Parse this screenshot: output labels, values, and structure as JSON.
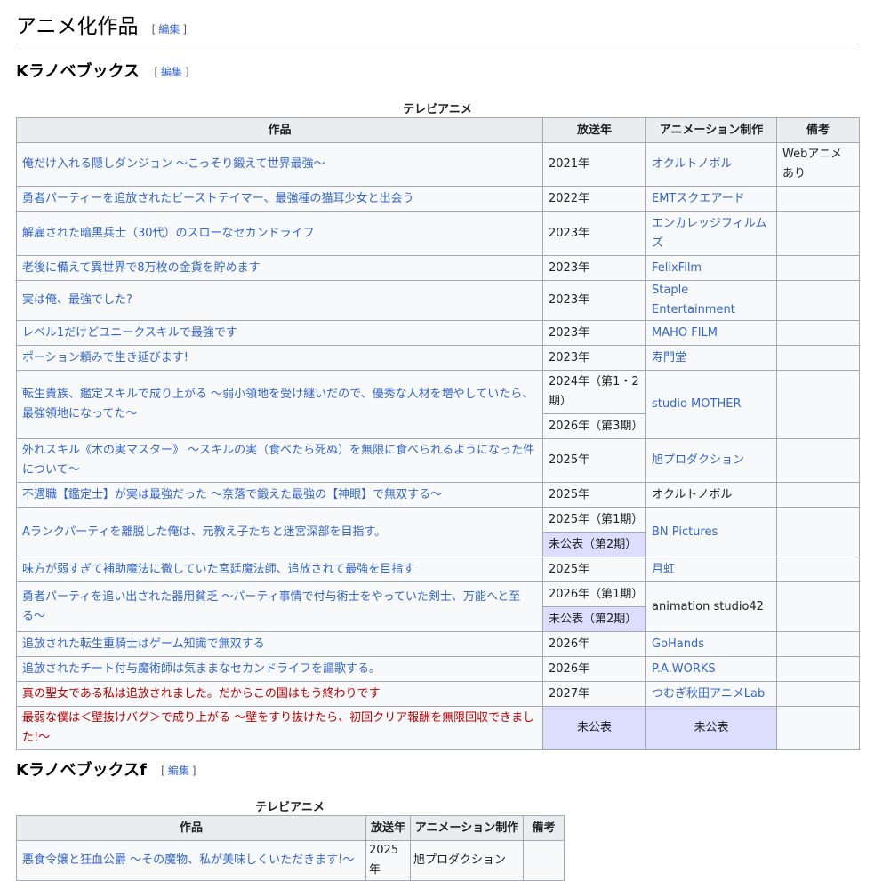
{
  "section": {
    "title": "アニメ化作品",
    "edit_label": "編集"
  },
  "subsections": [
    {
      "title": "Kラノベブックス",
      "edit_label": "編集"
    },
    {
      "title": "Kラノベブックスf",
      "edit_label": "編集"
    }
  ],
  "table1": {
    "caption": "テレビアニメ",
    "headers": [
      "作品",
      "放送年",
      "アニメーション制作",
      "備考"
    ],
    "rows": [
      {
        "title": "俺だけ入れる隠しダンジョン 〜こっそり鍛えて世界最強〜",
        "year": "2021年",
        "studio": "オクルトノボル",
        "note": "Webアニメあり"
      },
      {
        "title": "勇者パーティーを追放されたビーストテイマー、最強種の猫耳少女と出会う",
        "year": "2022年",
        "studio": "EMTスクエアード",
        "note": ""
      },
      {
        "title": "解雇された暗黒兵士（30代）のスローなセカンドライフ",
        "year": "2023年",
        "studio": "エンカレッジフィルムズ",
        "note": ""
      },
      {
        "title": "老後に備えて異世界で8万枚の金貨を貯めます",
        "year": "2023年",
        "studio": "FelixFilm",
        "note": ""
      },
      {
        "title": "実は俺、最強でした?",
        "year": "2023年",
        "studio": "Staple Entertainment",
        "note": ""
      },
      {
        "title": "レベル1だけどユニークスキルで最強です",
        "year": "2023年",
        "studio": "MAHO FILM",
        "note": ""
      },
      {
        "title": "ポーション頼みで生き延びます!",
        "year": "2023年",
        "studio": "寿門堂",
        "note": ""
      },
      {
        "title": "転生貴族、鑑定スキルで成り上がる 〜弱小領地を受け継いだので、優秀な人材を増やしていたら、最強領地になってた〜",
        "years": [
          "2024年（第1・2期）",
          "2026年（第3期）"
        ],
        "studio": "studio MOTHER",
        "note": ""
      },
      {
        "title": "外れスキル《木の実マスター》 〜スキルの実（食べたら死ぬ）を無限に食べられるようになった件について〜",
        "year": "2025年",
        "studio": "旭プロダクション",
        "note": ""
      },
      {
        "title": "不遇職【鑑定士】が実は最強だった 〜奈落で鍛えた最強の【神眼】で無双する〜",
        "year": "2025年",
        "studio": "オクルトノボル",
        "note": ""
      },
      {
        "title": "Aランクパーティを離脱した俺は、元教え子たちと迷宮深部を目指す。",
        "years": [
          "2025年（第1期）",
          "未公表（第2期）"
        ],
        "studio": "BN Pictures",
        "note": ""
      },
      {
        "title": "味方が弱すぎて補助魔法に徹していた宮廷魔法師、追放されて最強を目指す",
        "year": "2025年",
        "studio": "月虹",
        "note": ""
      },
      {
        "title": "勇者パーティを追い出された器用貧乏 〜パーティ事情で付与術士をやっていた剣士、万能へと至る〜",
        "years": [
          "2026年（第1期）",
          "未公表（第2期）"
        ],
        "studio": "animation studio42",
        "note": ""
      },
      {
        "title": "追放された転生重騎士はゲーム知識で無双する",
        "year": "2026年",
        "studio": "GoHands",
        "note": ""
      },
      {
        "title": "追放されたチート付与魔術師は気ままなセカンドライフを謳歌する。",
        "year": "2026年",
        "studio": "P.A.WORKS",
        "note": ""
      },
      {
        "title": "真の聖女である私は追放されました。だからこの国はもう終わりです",
        "year": "2027年",
        "studio": "つむぎ秋田アニメLab",
        "note": ""
      },
      {
        "title": "最弱な僕は＜壁抜けバグ＞で成り上がる 〜壁をすり抜けたら、初回クリア報酬を無限回収できました!〜",
        "year": "未公表",
        "studio": "未公表",
        "note": ""
      }
    ]
  },
  "table2": {
    "caption": "テレビアニメ",
    "headers": [
      "作品",
      "放送年",
      "アニメーション制作",
      "備考"
    ],
    "rows": [
      {
        "title": "悪食令嬢と狂血公爵 〜その魔物、私が美味しくいただきます!〜",
        "year": "2025年",
        "studio": "旭プロダクション",
        "note": ""
      }
    ]
  }
}
